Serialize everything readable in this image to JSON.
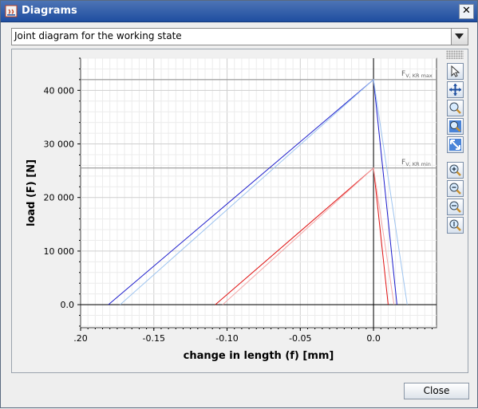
{
  "window": {
    "title": "Diagrams",
    "close_glyph": "✕"
  },
  "dropdown": {
    "selected": "Joint diagram for the working state"
  },
  "footer": {
    "close_label": "Close"
  },
  "toolbar": {
    "buttons": [
      "select-arrow-icon",
      "move-cross-icon",
      "zoom-icon",
      "zoom-box-icon",
      "zoom-fit-icon",
      "zoom-in-icon",
      "zoom-out-icon",
      "zoom-x-icon",
      "zoom-y-icon"
    ]
  },
  "chart_data": {
    "type": "line",
    "xlabel": "change in length (f) [mm]",
    "ylabel": "load (F) [N]",
    "xlim": [
      -0.2,
      0.043
    ],
    "ylim": [
      -4300,
      46000
    ],
    "x_ticks": [
      -0.2,
      -0.15,
      -0.1,
      -0.05,
      0.0
    ],
    "x_tick_labels": [
      ".20",
      "-0.15",
      "-0.10",
      "-0.05",
      "0.0"
    ],
    "y_ticks": [
      0,
      10000,
      20000,
      30000,
      40000
    ],
    "y_tick_labels": [
      "0.0",
      "10 000",
      "20 000",
      "30 000",
      "40 000"
    ],
    "grid": true,
    "reference_lines": [
      {
        "label_main": "F",
        "label_sub": "V, KR max",
        "y": 42000
      },
      {
        "label_main": "F",
        "label_sub": "V, KR min",
        "y": 25500
      }
    ],
    "series": [
      {
        "color": "#1a1acc",
        "x": [
          -0.181,
          0.0,
          0.016
        ],
        "y": [
          0,
          42000,
          0
        ]
      },
      {
        "color": "#9ec4f0",
        "x": [
          -0.173,
          0.0,
          0.023
        ],
        "y": [
          0,
          42000,
          0
        ]
      },
      {
        "color": "#e01010",
        "x": [
          -0.108,
          0.0,
          0.01
        ],
        "y": [
          0,
          25500,
          0
        ]
      },
      {
        "color": "#f4a8a8",
        "x": [
          -0.103,
          0.0,
          0.014
        ],
        "y": [
          0,
          25500,
          0
        ]
      }
    ]
  }
}
